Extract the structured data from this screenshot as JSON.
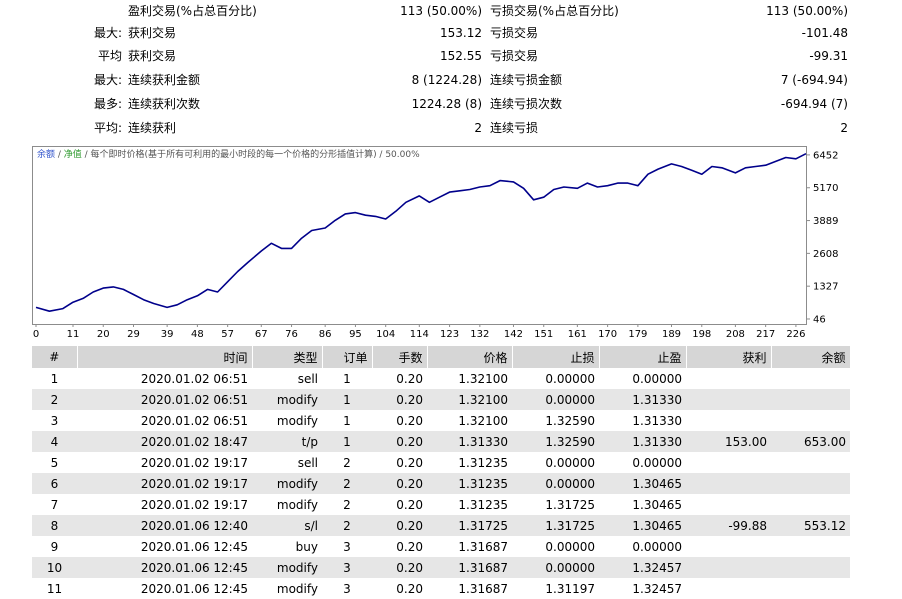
{
  "stats": [
    {
      "prefix": "",
      "left_label": "盈利交易(%占总百分比)",
      "left_value": "113 (50.00%)",
      "right_label": "亏损交易(%占总百分比)",
      "right_value": "113 (50.00%)"
    },
    {
      "prefix": "最大:",
      "left_label": "获利交易",
      "left_value": "153.12",
      "right_label": "亏损交易",
      "right_value": "-101.48"
    },
    {
      "prefix": "平均",
      "left_label": "获利交易",
      "left_value": "152.55",
      "right_label": "亏损交易",
      "right_value": "-99.31"
    },
    {
      "prefix": "最大:",
      "left_label": "连续获利金额",
      "left_value": "8 (1224.28)",
      "right_label": "连续亏损金额",
      "right_value": "7 (-694.94)"
    },
    {
      "prefix": "最多:",
      "left_label": "连续获利次数",
      "left_value": "1224.28 (8)",
      "right_label": "连续亏损次数",
      "right_value": "-694.94 (7)"
    },
    {
      "prefix": "平均:",
      "left_label": "连续获利",
      "left_value": "2",
      "right_label": "连续亏损",
      "right_value": "2"
    }
  ],
  "chart_data": {
    "type": "line",
    "legend_parts": [
      "余额",
      " / ",
      "净值",
      " / 每个即时价格(基于所有可利用的最小时段的每一个价格的分形插值计算) / 50.00%"
    ],
    "x_ticks": [
      0,
      11,
      20,
      29,
      39,
      48,
      57,
      67,
      76,
      86,
      95,
      104,
      114,
      123,
      132,
      142,
      151,
      161,
      170,
      179,
      189,
      198,
      208,
      217,
      226
    ],
    "y_ticks": [
      46,
      1327,
      2608,
      3889,
      5170,
      6452
    ],
    "xlim": [
      0,
      229
    ],
    "ylim": [
      -150,
      6800
    ],
    "grid": false,
    "series": [
      {
        "color": "#00008b",
        "x": [
          0,
          4,
          8,
          11,
          14,
          17,
          20,
          23,
          26,
          29,
          32,
          35,
          39,
          42,
          45,
          48,
          51,
          54,
          57,
          60,
          63,
          67,
          70,
          73,
          76,
          79,
          82,
          86,
          89,
          92,
          95,
          98,
          101,
          104,
          107,
          110,
          114,
          117,
          120,
          123,
          126,
          129,
          132,
          135,
          138,
          142,
          145,
          148,
          151,
          154,
          157,
          161,
          164,
          167,
          170,
          173,
          176,
          179,
          182,
          185,
          189,
          192,
          195,
          198,
          201,
          204,
          208,
          211,
          214,
          217,
          220,
          223,
          226,
          229
        ],
        "y": [
          500,
          350,
          450,
          700,
          850,
          1100,
          1250,
          1300,
          1200,
          1000,
          800,
          650,
          500,
          600,
          800,
          950,
          1200,
          1100,
          1500,
          1900,
          2250,
          2700,
          3000,
          2800,
          2800,
          3200,
          3500,
          3600,
          3900,
          4150,
          4200,
          4100,
          4050,
          3950,
          4250,
          4600,
          4850,
          4600,
          4800,
          5000,
          5050,
          5100,
          5200,
          5250,
          5450,
          5400,
          5150,
          4700,
          4800,
          5100,
          5200,
          5150,
          5350,
          5200,
          5250,
          5350,
          5350,
          5250,
          5700,
          5900,
          6100,
          6000,
          5850,
          5700,
          6000,
          5950,
          5750,
          5950,
          6000,
          6050,
          6200,
          6350,
          6300,
          6500
        ]
      }
    ]
  },
  "table": {
    "headers": [
      "#",
      "时间",
      "类型",
      "订单",
      "手数",
      "价格",
      "止损",
      "止盈",
      "获利",
      "余额"
    ],
    "rows": [
      [
        "1",
        "2020.01.02 06:51",
        "sell",
        "1",
        "0.20",
        "1.32100",
        "0.00000",
        "0.00000",
        "",
        ""
      ],
      [
        "2",
        "2020.01.02 06:51",
        "modify",
        "1",
        "0.20",
        "1.32100",
        "0.00000",
        "1.31330",
        "",
        ""
      ],
      [
        "3",
        "2020.01.02 06:51",
        "modify",
        "1",
        "0.20",
        "1.32100",
        "1.32590",
        "1.31330",
        "",
        ""
      ],
      [
        "4",
        "2020.01.02 18:47",
        "t/p",
        "1",
        "0.20",
        "1.31330",
        "1.32590",
        "1.31330",
        "153.00",
        "653.00"
      ],
      [
        "5",
        "2020.01.02 19:17",
        "sell",
        "2",
        "0.20",
        "1.31235",
        "0.00000",
        "0.00000",
        "",
        ""
      ],
      [
        "6",
        "2020.01.02 19:17",
        "modify",
        "2",
        "0.20",
        "1.31235",
        "0.00000",
        "1.30465",
        "",
        ""
      ],
      [
        "7",
        "2020.01.02 19:17",
        "modify",
        "2",
        "0.20",
        "1.31235",
        "1.31725",
        "1.30465",
        "",
        ""
      ],
      [
        "8",
        "2020.01.06 12:40",
        "s/l",
        "2",
        "0.20",
        "1.31725",
        "1.31725",
        "1.30465",
        "-99.88",
        "553.12"
      ],
      [
        "9",
        "2020.01.06 12:45",
        "buy",
        "3",
        "0.20",
        "1.31687",
        "0.00000",
        "0.00000",
        "",
        ""
      ],
      [
        "10",
        "2020.01.06 12:45",
        "modify",
        "3",
        "0.20",
        "1.31687",
        "0.00000",
        "1.32457",
        "",
        ""
      ],
      [
        "11",
        "2020.01.06 12:45",
        "modify",
        "3",
        "0.20",
        "1.31687",
        "1.31197",
        "1.32457",
        "",
        ""
      ]
    ]
  },
  "colors": {
    "line": "#00008b",
    "balance_legend": "#3355cc",
    "equity_legend": "#2e9a2e",
    "header_bg": "#d6d6d6",
    "alt_row_bg": "#e6e6e6"
  }
}
